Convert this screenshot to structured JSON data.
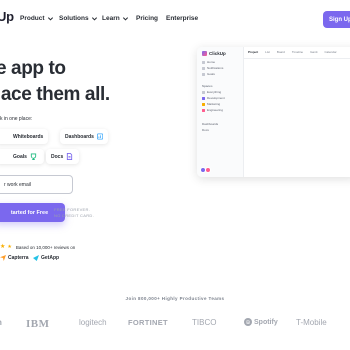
{
  "nav": {
    "logo": "Up",
    "items": [
      {
        "label": "Product",
        "has_dropdown": true
      },
      {
        "label": "Solutions",
        "has_dropdown": true
      },
      {
        "label": "Learn",
        "has_dropdown": true
      },
      {
        "label": "Pricing",
        "has_dropdown": false
      },
      {
        "label": "Enterprise",
        "has_dropdown": false
      }
    ],
    "signup": "Sign Up"
  },
  "hero": {
    "line1": "e app to",
    "line2": "lace them all.",
    "subtitle": "k in one place:",
    "features": [
      {
        "label": "Whiteboards",
        "icon": "whiteboard-icon",
        "color": "#f8ae00"
      },
      {
        "label": "Dashboards",
        "icon": "dashboard-icon",
        "color": "#3da9fc"
      },
      {
        "label": "Goals",
        "icon": "goal-trophy-icon",
        "color": "#1fbb80"
      },
      {
        "label": "Docs",
        "icon": "doc-icon",
        "color": "#7b68ee"
      }
    ],
    "email_placeholder": "r work email",
    "cta": "tarted for Free",
    "cta_note_1": "FREE FOREVER.",
    "cta_note_2": "NO CREDIT CARD.",
    "rating_text": "Based on 10,000+ reviews on",
    "review_sites": [
      "Capterra",
      "GetApp"
    ]
  },
  "app_preview": {
    "logo": "ClickUp",
    "tabs": [
      "Project",
      "List",
      "Board",
      "Timeline",
      "Gantt",
      "Calendar"
    ],
    "sidebar_items": [
      "Home",
      "Notifications",
      "Goals"
    ],
    "spaces_heading": "Spaces",
    "spaces": [
      {
        "label": "Everything",
        "color": "#c6c9d2"
      },
      {
        "label": "Development",
        "color": "#7b68ee"
      },
      {
        "label": "Marketing",
        "color": "#f8ae00"
      },
      {
        "label": "Engineering",
        "color": "#ff5d8f"
      }
    ],
    "lower_items": [
      "Dashboards",
      "Docs"
    ]
  },
  "logos": {
    "heading": "Join 800,000+ Highly Productive Teams",
    "brands": [
      "n",
      "IBM",
      "logitech",
      "FORTINET",
      "TIBCO",
      "Spotify",
      "T-Mobile"
    ]
  },
  "colors": {
    "accent": "#7b68ee",
    "text": "#292d34",
    "muted": "#7c828d",
    "star": "#f8ae00"
  }
}
